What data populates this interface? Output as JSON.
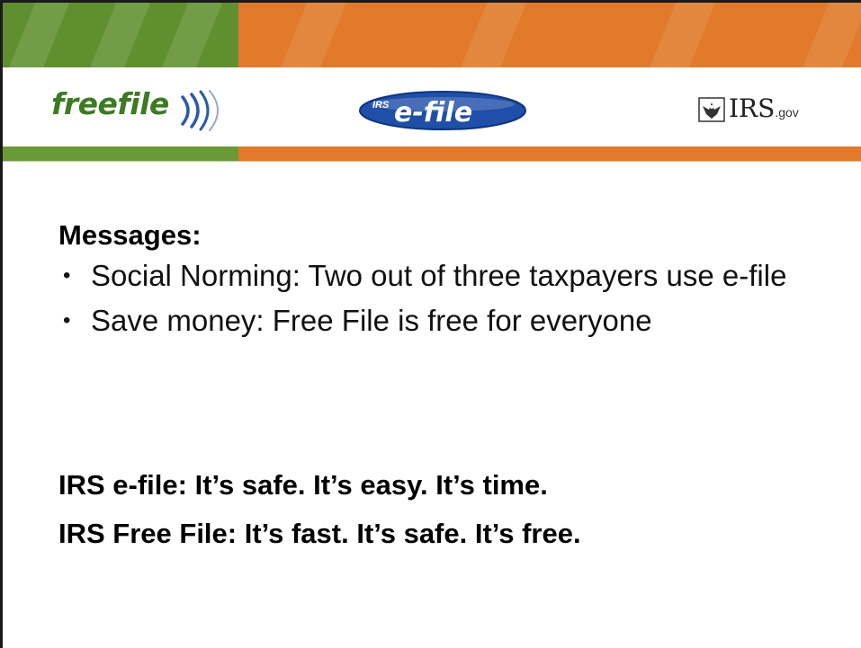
{
  "header": {
    "logos": {
      "freefile": "freefile",
      "efile_badge": "IRS",
      "efile": "e-file",
      "irs": "IRS",
      "irs_suffix": ".gov"
    },
    "colors": {
      "green_band": "#5f8f2f",
      "orange_band": "#e17a2b",
      "freefile_green": "#3d7a23",
      "efile_blue": "#1f4fa8"
    }
  },
  "messages": {
    "heading": "Messages:",
    "bullets": [
      {
        "label": "Social Norming: Two out of three taxpayers use e-file"
      },
      {
        "label": "Save money: Free File is free for everyone"
      }
    ]
  },
  "taglines": [
    "IRS e-file: It’s safe. It’s easy. It’s time.",
    "IRS Free File: It’s fast. It’s safe. It’s free."
  ]
}
